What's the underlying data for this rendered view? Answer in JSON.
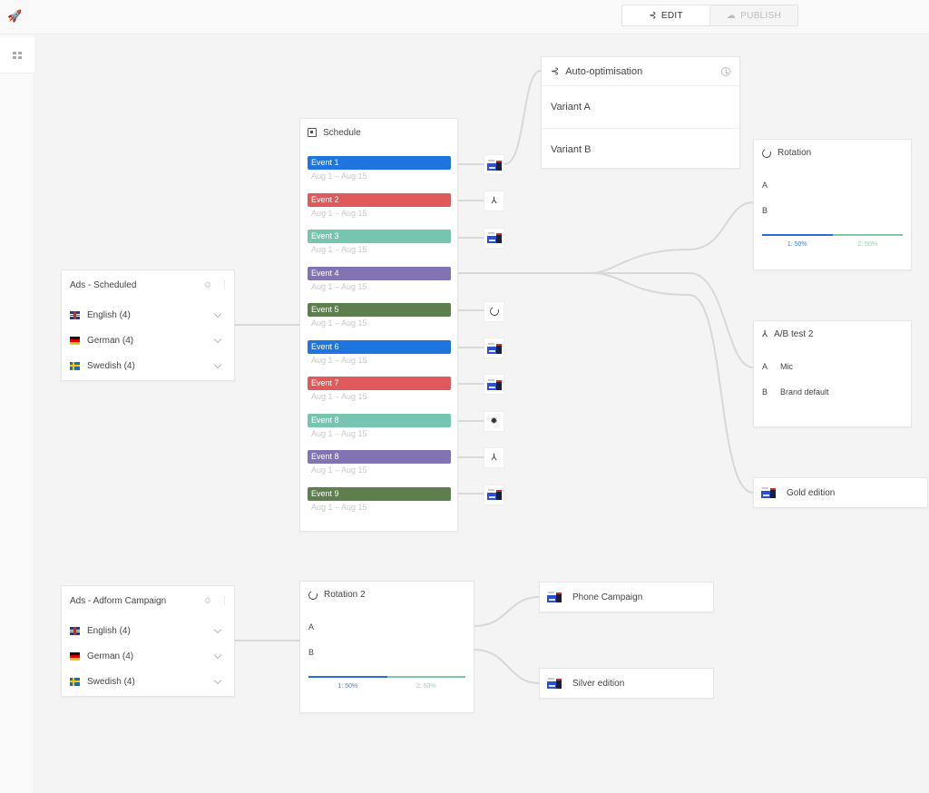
{
  "toolbar": {
    "rocket_icon": "rocket-icon",
    "edit_label": "EDIT",
    "publish_label": "PUBLISH",
    "active_mode": "edit"
  },
  "sidebar": {
    "items": [
      {
        "icon": "grid-icon",
        "active": true
      }
    ]
  },
  "ads_groups": [
    {
      "title": "Ads - Scheduled",
      "languages": [
        {
          "flag": "uk",
          "label": "English (4)"
        },
        {
          "flag": "de",
          "label": "German (4)"
        },
        {
          "flag": "se",
          "label": "Swedish (4)"
        }
      ]
    },
    {
      "title": "Ads - Adform Campaign",
      "languages": [
        {
          "flag": "uk",
          "label": "English (4)"
        },
        {
          "flag": "de",
          "label": "German (4)"
        },
        {
          "flag": "se",
          "label": "Swedish (4)"
        }
      ]
    }
  ],
  "schedule": {
    "title": "Schedule",
    "events": [
      {
        "name": "Event 1",
        "dates": "Aug 1 – Aug 15",
        "color": "#1f74e0",
        "target": "creative"
      },
      {
        "name": "Event 2",
        "dates": "Aug 1 – Aug 15",
        "color": "#e05a5c",
        "target": "ab-test"
      },
      {
        "name": "Event 3",
        "dates": "Aug 1 – Aug 15",
        "color": "#77c5b1",
        "target": "creative"
      },
      {
        "name": "Event 4",
        "dates": "Aug 1 – Aug 15",
        "color": "#8274b3",
        "target": "branch"
      },
      {
        "name": "Event 5",
        "dates": "Aug 1 – Aug 15",
        "color": "#5e7e4e",
        "target": "rotation"
      },
      {
        "name": "Event 6",
        "dates": "Aug 1 – Aug 15",
        "color": "#1f74e0",
        "target": "creative"
      },
      {
        "name": "Event 7",
        "dates": "Aug 1 – Aug 15",
        "color": "#e05a5c",
        "target": "creative"
      },
      {
        "name": "Event 8",
        "dates": "Aug 1 – Aug 15",
        "color": "#77c5b1",
        "target": "sun"
      },
      {
        "name": "Event 8",
        "dates": "Aug 1 – Aug 15",
        "color": "#8274b3",
        "target": "ab-test"
      },
      {
        "name": "Event 9",
        "dates": "Aug 1 – Aug 15",
        "color": "#5e7e4e",
        "target": "creative"
      }
    ]
  },
  "auto_optimisation": {
    "title": "Auto-optimisation",
    "variants": [
      "Variant A",
      "Variant B"
    ]
  },
  "rotation": {
    "title": "Rotation",
    "rows": [
      "A",
      "B"
    ],
    "split": [
      {
        "label": "1: 50%",
        "percent": 50,
        "color": "#2f6bd8"
      },
      {
        "label": "2: 50%",
        "percent": 50,
        "color": "#7ec8a8"
      }
    ]
  },
  "ab_test": {
    "title": "A/B test 2",
    "rows": [
      {
        "key": "A",
        "value": "Mic"
      },
      {
        "key": "B",
        "value": "Brand default"
      }
    ]
  },
  "gold": {
    "label": "Gold edition"
  },
  "rotation2": {
    "title": "Rotation 2",
    "rows": [
      "A",
      "B"
    ],
    "split": [
      {
        "label": "1: 50%",
        "percent": 50,
        "color": "#2f6bd8"
      },
      {
        "label": "2: 50%",
        "percent": 50,
        "color": "#7ec8a8"
      }
    ]
  },
  "phone": {
    "label": "Phone Campaign"
  },
  "silver": {
    "label": "Silver edition"
  }
}
